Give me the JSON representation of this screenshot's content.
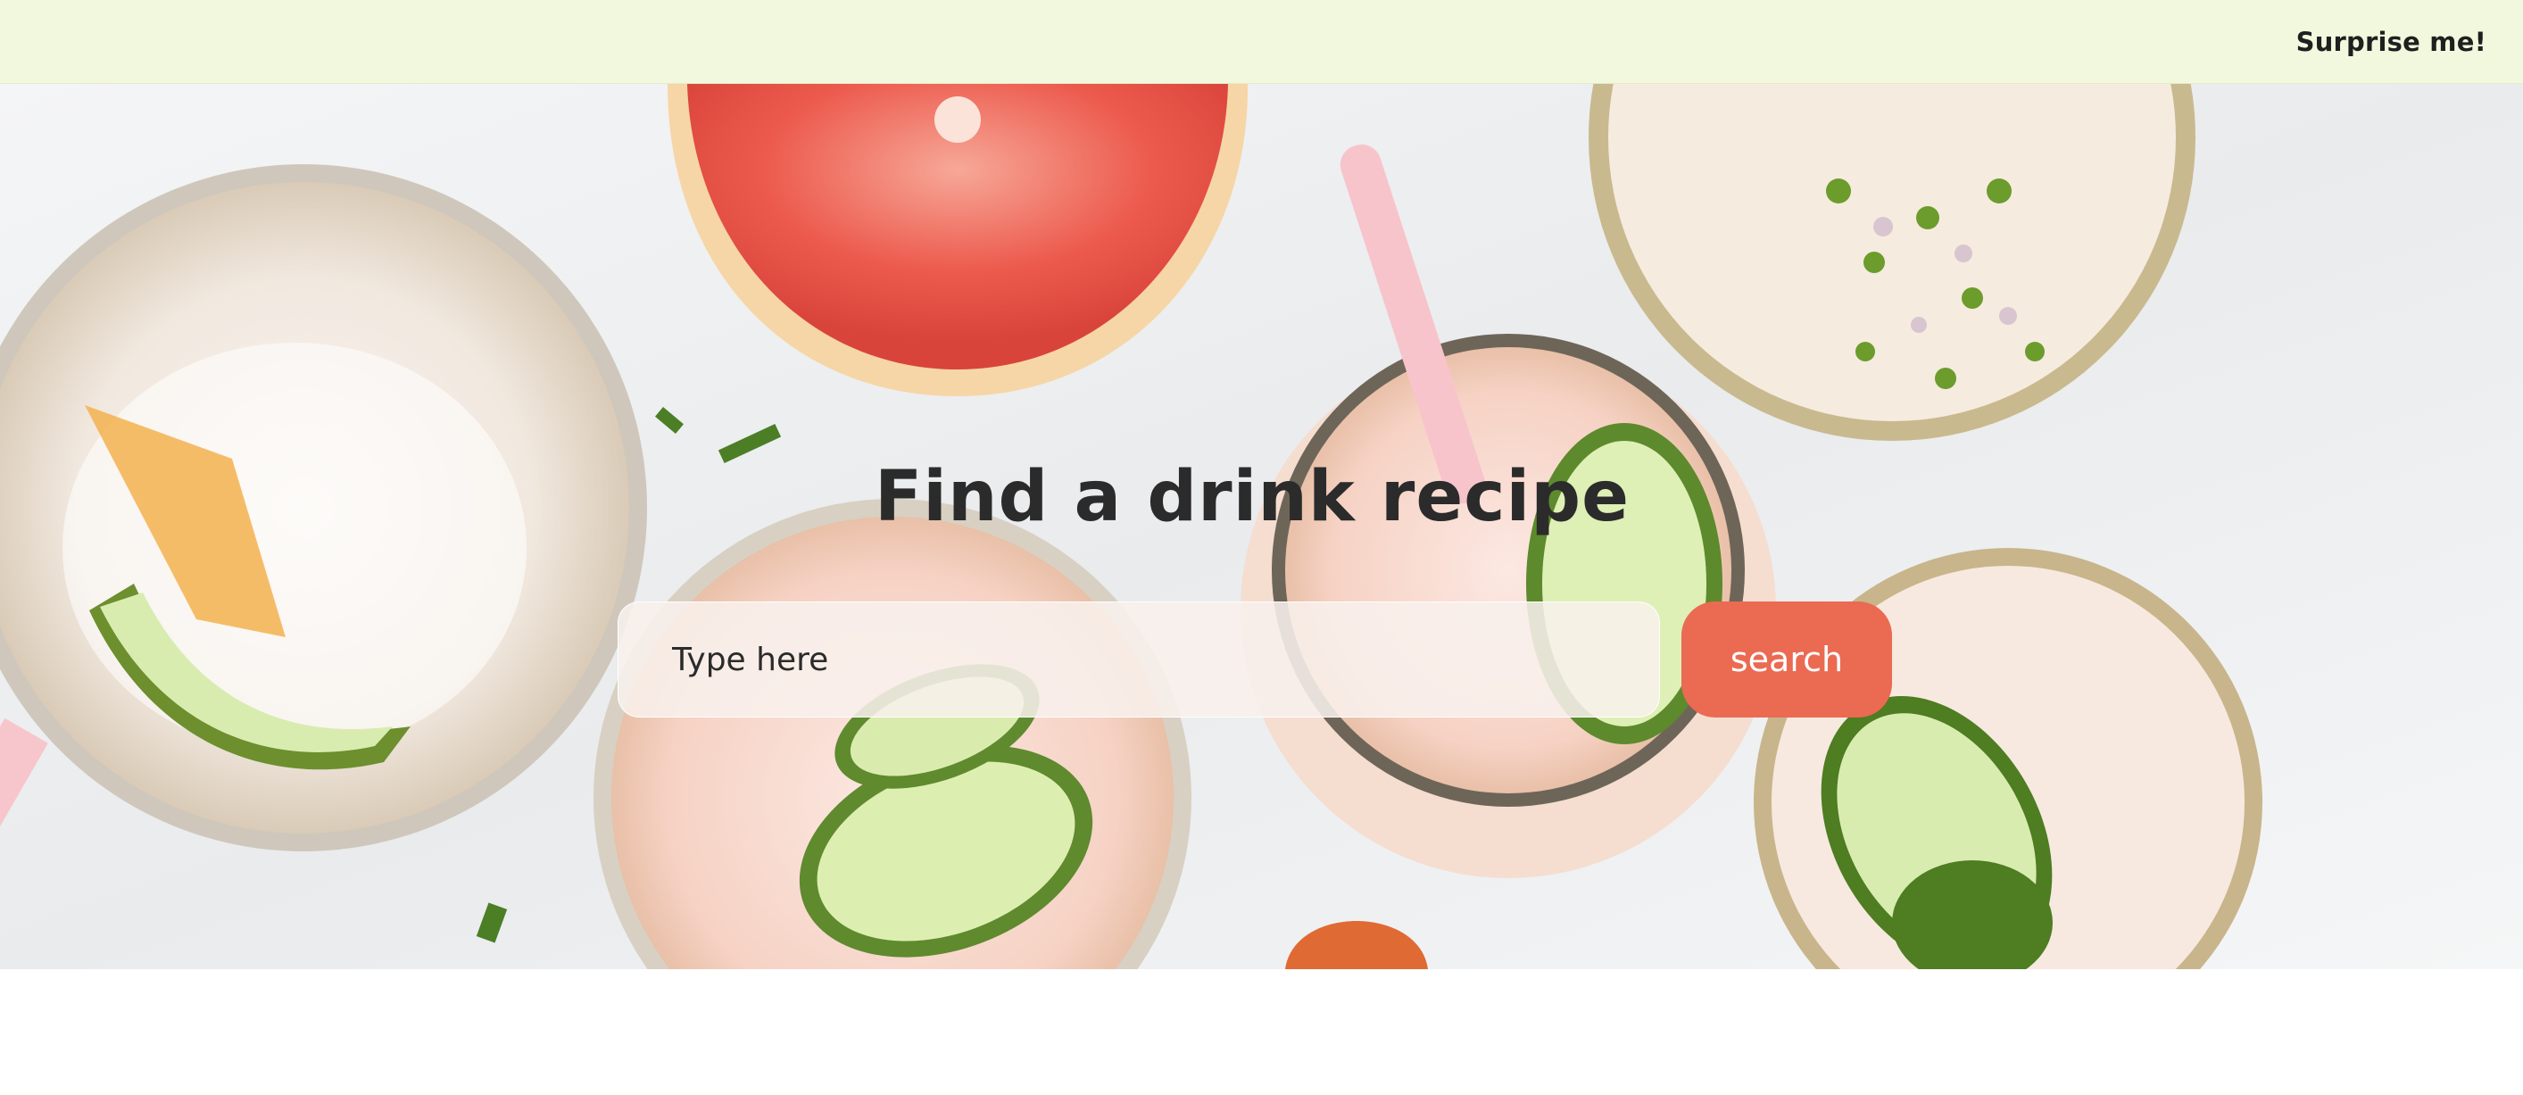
{
  "header": {
    "surprise_label": "Surprise me!"
  },
  "hero": {
    "title": "Find a drink recipe",
    "search_placeholder": "Type here",
    "search_button_label": "search",
    "accent_color": "#eb6a52",
    "header_bg_color": "#f2f8de"
  }
}
